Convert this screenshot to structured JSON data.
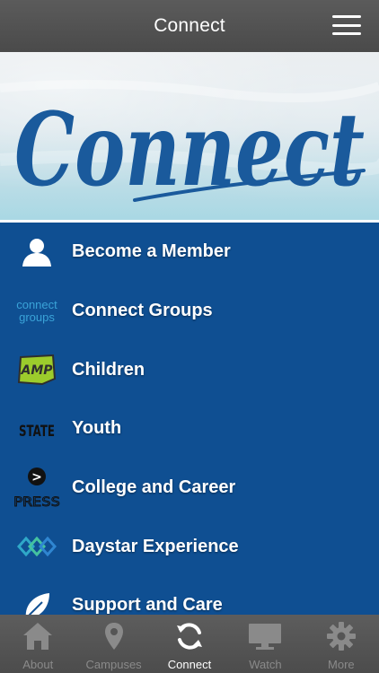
{
  "header": {
    "title": "Connect"
  },
  "banner": {
    "script_text": "Connect"
  },
  "menu": {
    "items": [
      {
        "label": "Become a Member",
        "icon": "person-icon"
      },
      {
        "label": "Connect Groups",
        "icon": "connect-groups-logo"
      },
      {
        "label": "Children",
        "icon": "amp-logo"
      },
      {
        "label": "Youth",
        "icon": "state-logo"
      },
      {
        "label": "College and Career",
        "icon": "press-logo"
      },
      {
        "label": "Daystar Experience",
        "icon": "daystar-logo"
      },
      {
        "label": "Support and Care",
        "icon": "leaf-icon"
      }
    ],
    "logos": {
      "connect_groups_line1": "connect",
      "connect_groups_line2": "groups",
      "amp_text": "AMP",
      "state_text": "STATE",
      "press_arrow": ">",
      "press_text": "PRESS"
    }
  },
  "tabbar": {
    "tabs": [
      {
        "label": "About",
        "icon": "home-icon",
        "active": false
      },
      {
        "label": "Campuses",
        "icon": "location-pin-icon",
        "active": false
      },
      {
        "label": "Connect",
        "icon": "refresh-icon",
        "active": true
      },
      {
        "label": "Watch",
        "icon": "monitor-icon",
        "active": false
      },
      {
        "label": "More",
        "icon": "gear-icon",
        "active": false
      }
    ]
  },
  "colors": {
    "header_bg": "#4f4f4f",
    "list_bg": "#0f4f92",
    "banner_script": "#1a5a9c",
    "tab_inactive": "#8a8a8a",
    "tab_active": "#ffffff"
  }
}
